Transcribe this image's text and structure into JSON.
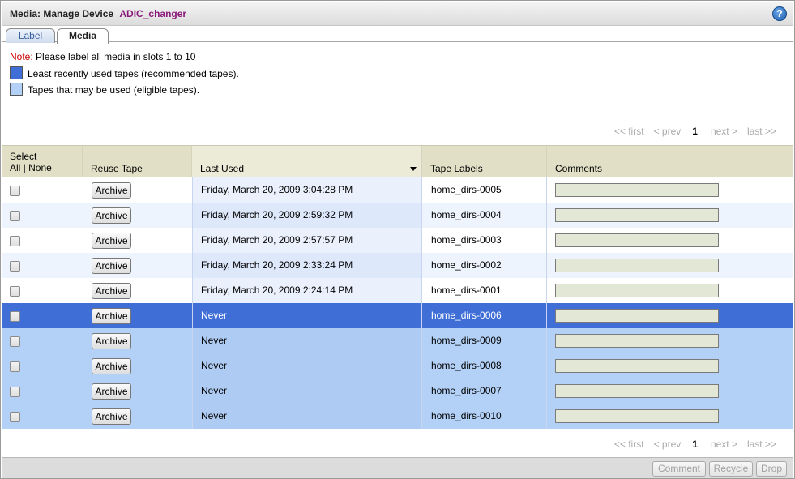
{
  "window": {
    "title": "Media: Manage Device",
    "device": "ADIC_changer"
  },
  "tabs": [
    {
      "label": "Label",
      "active": false
    },
    {
      "label": "Media",
      "active": true
    }
  ],
  "note": {
    "label": "Note:",
    "text": " Please label all media in slots 1 to 10"
  },
  "legend": [
    {
      "color": "#3f6fd6",
      "text": "Least recently used tapes (recommended tapes)."
    },
    {
      "color": "#b3d1f7",
      "text": "Tapes that may be used (eligible tapes)."
    }
  ],
  "pager": {
    "first": "<< first",
    "prev": "< prev",
    "page": "1",
    "next": "next >",
    "last": "last >>"
  },
  "table": {
    "headers": {
      "select_line1": "Select",
      "select_line2": "All | None",
      "reuse": "Reuse Tape",
      "last_used": "Last Used",
      "labels": "Tape Labels",
      "comments": "Comments"
    },
    "button_label": "Archive",
    "rows": [
      {
        "last_used": "Friday, March 20, 2009 3:04:28 PM",
        "label": "home_dirs-0005",
        "style": "white"
      },
      {
        "last_used": "Friday, March 20, 2009 2:59:32 PM",
        "label": "home_dirs-0004",
        "style": "alt"
      },
      {
        "last_used": "Friday, March 20, 2009 2:57:57 PM",
        "label": "home_dirs-0003",
        "style": "white"
      },
      {
        "last_used": "Friday, March 20, 2009 2:33:24 PM",
        "label": "home_dirs-0002",
        "style": "alt"
      },
      {
        "last_used": "Friday, March 20, 2009 2:24:14 PM",
        "label": "home_dirs-0001",
        "style": "white"
      },
      {
        "last_used": "Never",
        "label": "home_dirs-0006",
        "style": "recommended"
      },
      {
        "last_used": "Never",
        "label": "home_dirs-0009",
        "style": "eligible"
      },
      {
        "last_used": "Never",
        "label": "home_dirs-0008",
        "style": "eligible"
      },
      {
        "last_used": "Never",
        "label": "home_dirs-0007",
        "style": "eligible"
      },
      {
        "last_used": "Never",
        "label": "home_dirs-0010",
        "style": "eligible"
      }
    ]
  },
  "footer": {
    "comment": "Comment",
    "recycle": "Recycle",
    "drop": "Drop"
  },
  "colors": {
    "recommended": "#3f6fd6",
    "eligible": "#b3d1f7",
    "row_alt": "#eef4fd",
    "header_bg": "#e1e0c6",
    "note_red": "#cc0000"
  }
}
